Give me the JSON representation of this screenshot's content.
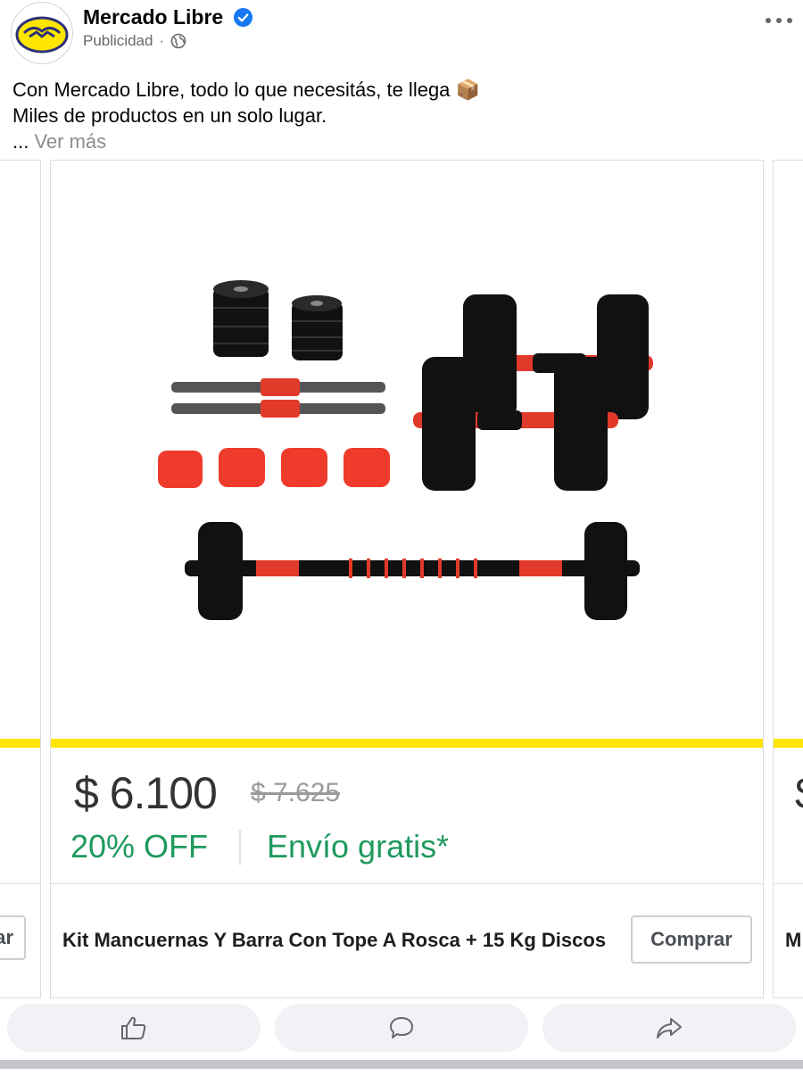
{
  "post": {
    "page_name": "Mercado Libre",
    "sponsored_label": "Publicidad",
    "separator": "·",
    "text_line1": "Con Mercado Libre, todo lo que necesitás, te llega 📦",
    "text_line2": "Miles de productos en un solo lugar.",
    "ellipsis": "...",
    "see_more": "Ver más"
  },
  "carousel": {
    "left_card": {
      "button_partial": "ar"
    },
    "main_card": {
      "price": "$ 6.100",
      "old_price": "$ 7.625",
      "discount": "20% OFF",
      "shipping": "Envío gratis*",
      "title": "Kit Mancuernas Y Barra Con Tope A Rosca + 15 Kg Discos",
      "button_label": "Comprar",
      "image_icon": "dumbbell-kit-icon"
    },
    "right_card": {
      "price_partial": "$",
      "title_partial": "M"
    }
  },
  "actions": [
    {
      "icon": "like-icon"
    },
    {
      "icon": "comment-icon"
    },
    {
      "icon": "share-icon"
    }
  ],
  "colors": {
    "yellow_band": "#ffe600",
    "green_text": "#1f9a5e",
    "verified_blue": "#1877f2"
  }
}
